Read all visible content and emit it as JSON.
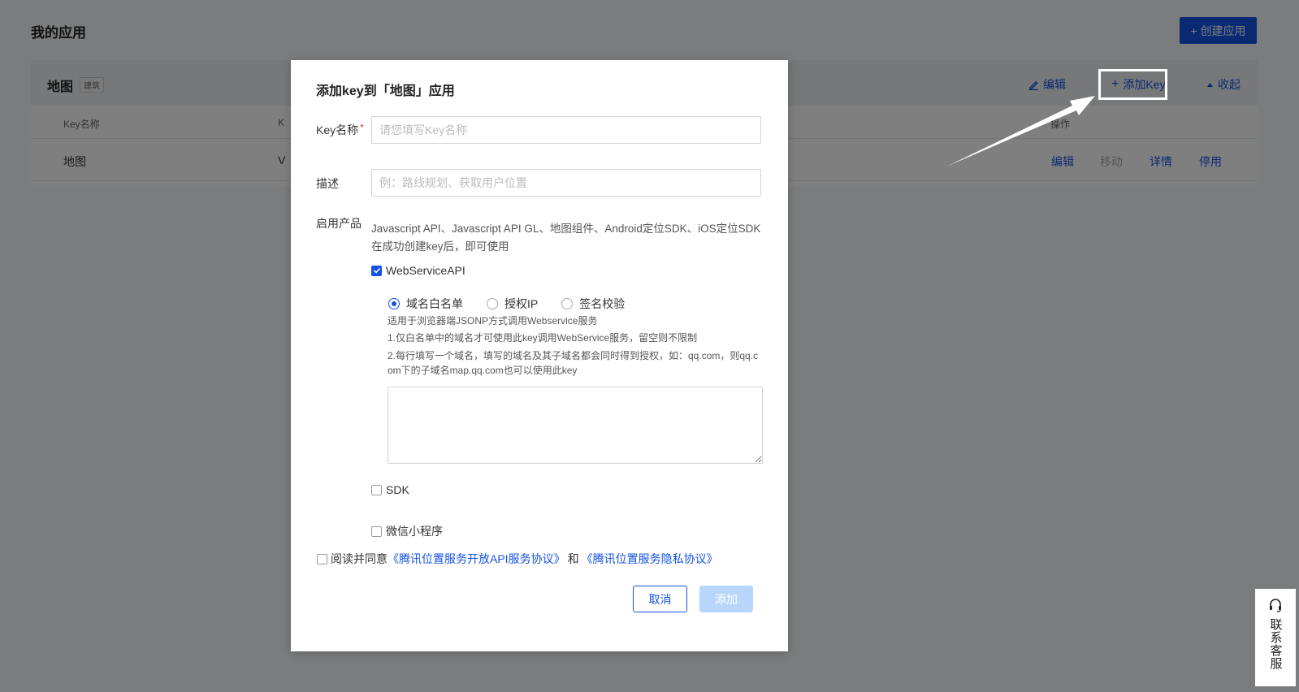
{
  "page": {
    "title": "我的应用",
    "create_button": "+ 创建应用"
  },
  "app": {
    "name": "地图",
    "tag": "建筑",
    "actions": {
      "edit": "编辑",
      "add_key": "添加Key",
      "collapse": "收起"
    },
    "columns": {
      "key_name": "Key名称",
      "key": "K",
      "operation": "操作"
    },
    "row": {
      "name": "地图",
      "key_prefix": "V",
      "actions": {
        "edit": "编辑",
        "move": "移动",
        "detail": "详情",
        "disable": "停用"
      }
    }
  },
  "modal": {
    "title": "添加key到「地图」应用",
    "key_name": {
      "label": "Key名称",
      "required_mark": "*",
      "placeholder": "请您填写Key名称"
    },
    "description": {
      "label": "描述",
      "placeholder": "例：路线规划、获取用户位置"
    },
    "products": {
      "label": "启用产品",
      "text": "Javascript API、Javascript API GL、地图组件、Android定位SDK、iOS定位SDK在成功创建key后，即可使用",
      "webservice": {
        "label": "WebServiceAPI",
        "checked": true,
        "options": [
          {
            "label": "域名白名单",
            "selected": true
          },
          {
            "label": "授权IP",
            "selected": false
          },
          {
            "label": "签名校验",
            "selected": false
          }
        ],
        "help": [
          "适用于浏览器端JSONP方式调用Webservice服务",
          "1.仅白名单中的域名才可使用此key调用WebService服务，留空则不限制",
          "2.每行填写一个域名，填写的域名及其子域名都会同时得到授权，如：qq.com，则qq.com下的子域名map.qq.com也可以使用此key"
        ]
      },
      "sdk": {
        "label": "SDK",
        "checked": false
      },
      "miniprogram": {
        "label": "微信小程序",
        "checked": false
      }
    },
    "agreement": {
      "prefix": "阅读并同意",
      "link1": "《腾讯位置服务开放API服务协议》",
      "and": "和",
      "link2": "《腾讯位置服务隐私协议》"
    },
    "buttons": {
      "cancel": "取消",
      "add": "添加"
    }
  },
  "support": {
    "label": "联系客服",
    "icon": "headset-icon"
  },
  "colors": {
    "primary": "#1452e6",
    "disabled_primary": "#b8d6fb",
    "required": "#e53935"
  }
}
